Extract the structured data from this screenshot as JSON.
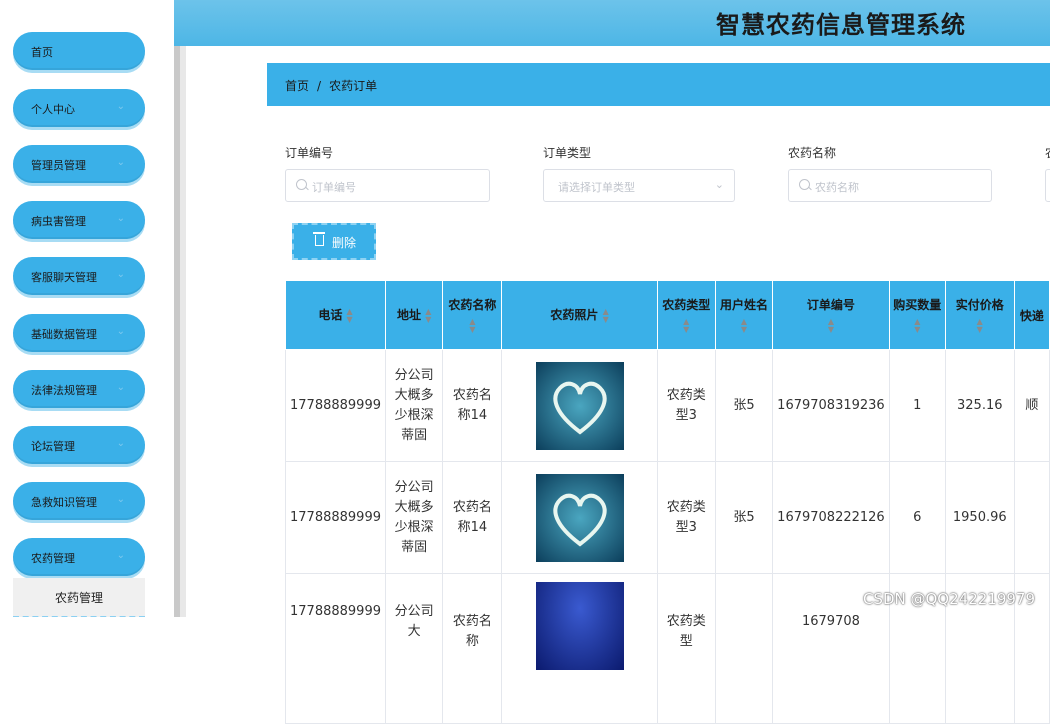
{
  "header": {
    "title": "智慧农药信息管理系统"
  },
  "sidebar": {
    "items": [
      {
        "label": "首页"
      },
      {
        "label": "个人中心"
      },
      {
        "label": "管理员管理"
      },
      {
        "label": "病虫害管理"
      },
      {
        "label": "客服聊天管理"
      },
      {
        "label": "基础数据管理"
      },
      {
        "label": "法律法规管理"
      },
      {
        "label": "论坛管理"
      },
      {
        "label": "急救知识管理"
      },
      {
        "label": "农药管理"
      }
    ],
    "sub_item": "农药管理"
  },
  "breadcrumb": {
    "home": "首页",
    "sep": "/",
    "current": "农药订单"
  },
  "filters": {
    "order_no": {
      "label": "订单编号",
      "placeholder": "订单编号"
    },
    "order_type": {
      "label": "订单类型",
      "placeholder": "请选择订单类型"
    },
    "pesticide_name": {
      "label": "农药名称",
      "placeholder": "农药名称"
    },
    "fourth_label": "农"
  },
  "toolbar": {
    "delete_label": "删除"
  },
  "table": {
    "columns": [
      "电话",
      "地址",
      "农药名称",
      "农药照片",
      "农药类型",
      "用户姓名",
      "订单编号",
      "购买数量",
      "实付价格",
      "快递"
    ],
    "rows": [
      {
        "phone": "17788889999",
        "address": "分公司大概多少根深蒂固",
        "name": "农药名称14",
        "type": "农药类型3",
        "user": "张5",
        "order_no": "1679708319236",
        "qty": "1",
        "price": "325.16",
        "express": "顺"
      },
      {
        "phone": "17788889999",
        "address": "分公司大概多少根深蒂固",
        "name": "农药名称14",
        "type": "农药类型3",
        "user": "张5",
        "order_no": "1679708222126",
        "qty": "6",
        "price": "1950.96",
        "express": ""
      },
      {
        "phone": "17788889999",
        "address": "分公司大",
        "name": "农药名称",
        "type": "农药类型",
        "user": "",
        "order_no": "1679708",
        "qty": "",
        "price": "",
        "express": ""
      }
    ]
  },
  "watermark": "CSDN @QQ242219979",
  "colors": {
    "accent": "#3ab0e8",
    "topbar": "#5bbde8"
  }
}
